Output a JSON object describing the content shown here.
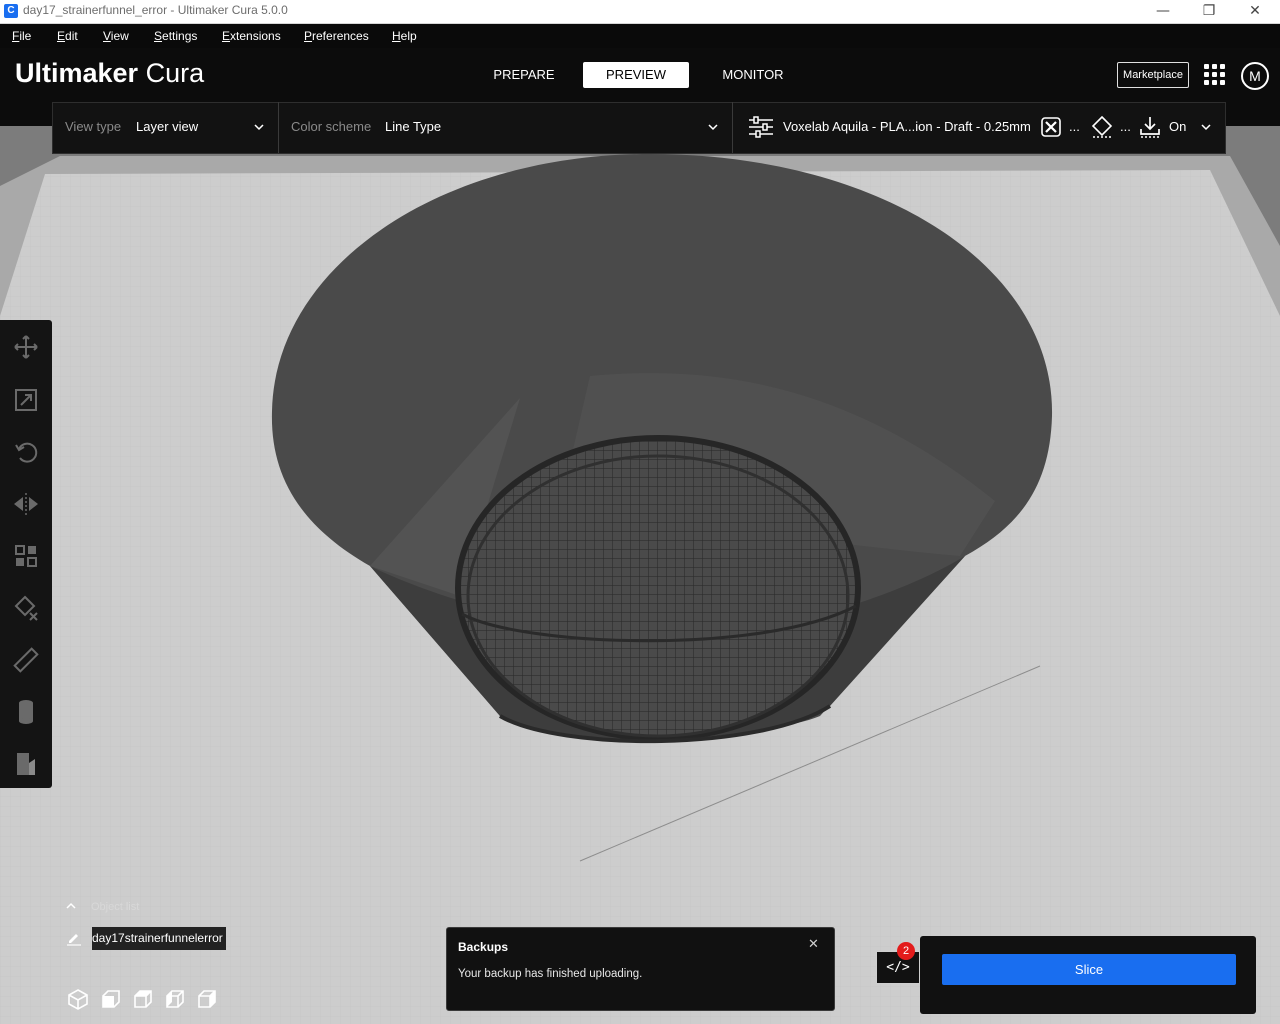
{
  "window": {
    "title": "day17_strainerfunnel_error - Ultimaker Cura 5.0.0",
    "app_icon_glyph": "C",
    "controls": [
      "minimize-icon",
      "restore-icon",
      "close-icon"
    ]
  },
  "menu": {
    "items": [
      {
        "key": "F",
        "rest": "ile"
      },
      {
        "key": "E",
        "rest": "dit"
      },
      {
        "key": "V",
        "rest": "iew"
      },
      {
        "key": "S",
        "rest": "ettings"
      },
      {
        "key": "E",
        "rest": "xtensions"
      },
      {
        "key": "P",
        "rest": "references"
      },
      {
        "key": "H",
        "rest": "elp"
      }
    ]
  },
  "header": {
    "logo_bold": "Ultimaker",
    "logo_light": "Cura",
    "stages": [
      "PREPARE",
      "PREVIEW",
      "MONITOR"
    ],
    "active_stage": "PREVIEW",
    "marketplace_label": "Marketplace",
    "avatar_initial": "M"
  },
  "toolbar": {
    "view_type_label": "View type",
    "view_type_value": "Layer view",
    "color_scheme_label": "Color scheme",
    "color_scheme_value": "Line Type",
    "profile": "Voxelab Aquila - PLA...ion - Draft - 0.25mm",
    "support_ellipsis": "...",
    "adhesion_ellipsis": "...",
    "adhesion_value": "On"
  },
  "tools": [
    "move-icon",
    "scale-icon",
    "rotate-icon",
    "mirror-icon",
    "per-model-settings-icon",
    "support-blocker-icon",
    "measure-icon",
    "cylinder-icon",
    "layer-object-icon"
  ],
  "object_list": {
    "title": "Object list",
    "object_name": "day17strainerfunnelerror"
  },
  "message": {
    "title": "Backups",
    "text": "Your backup has finished uploading."
  },
  "notifications": {
    "count": "2"
  },
  "slice": {
    "label": "Slice"
  },
  "colors": {
    "accent": "#196ef0",
    "header_bg": "#0c0c0c",
    "badge": "#e31b1b"
  }
}
